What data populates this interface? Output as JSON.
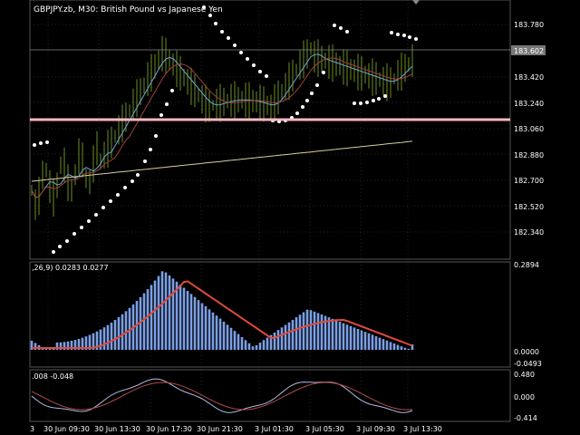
{
  "header": {
    "symbol_info": "GBPJPY.zb, M30:  British Pound vs Japanese Yen"
  },
  "macd_panel": {
    "label": ",26,9) 0.0283 0.0277"
  },
  "osc_panel": {
    "label": ".008 -0.048"
  },
  "price_axis": {
    "ticks": [
      "183.780",
      "183.600",
      "183.420",
      "183.240",
      "183.060",
      "182.880",
      "182.700",
      "182.520",
      "182.340"
    ],
    "current_price": "183.602"
  },
  "macd_axis": {
    "ticks": [
      "0.2894",
      "0.0000",
      "-0.0493"
    ]
  },
  "osc_axis": {
    "ticks": [
      "0.480",
      "0.000",
      "-0.414"
    ]
  },
  "time_axis": {
    "labels": [
      "3",
      "30 Jun 09:30",
      "30 Jun 13:30",
      "30 Jun 17:30",
      "30 Jun 21:30",
      "3 Jul 01:30",
      "3 Jul 05:30",
      "3 Jul 09:30",
      "3 Jul 13:30"
    ]
  },
  "colors": {
    "background": "#000000",
    "candle": "#6b8e23",
    "sar_dots": "#ffffff",
    "ma_fast": "#6ea6d8",
    "ma_slow": "#a0403c",
    "ma_long": "#d8cfa0",
    "support_line": "#f5b7c2",
    "histogram": "#7b9fe6",
    "signal": "#e04a3a",
    "osc_a": "#b0b8e0",
    "osc_b": "#b04a4a",
    "grid": "#555555"
  }
}
